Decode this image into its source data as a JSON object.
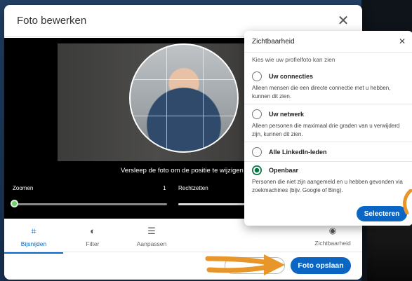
{
  "modal": {
    "title": "Foto bewerken"
  },
  "editor": {
    "drag_hint": "Versleep de foto om de positie te wijzigen",
    "zoom": {
      "label": "Zoomen",
      "value": "1",
      "level": 0
    },
    "straighten": {
      "label": "Rechtzetten"
    }
  },
  "tools": [
    {
      "label": "Bijsnijden",
      "icon": "crop-icon",
      "active": true
    },
    {
      "label": "Filter",
      "icon": "filter-icon",
      "active": false
    },
    {
      "label": "Aanpassen",
      "icon": "sliders-icon",
      "active": false
    }
  ],
  "visibility_tool": {
    "label": "Zichtbaarheid",
    "icon": "eye-icon"
  },
  "footer": {
    "save_label": "Foto opslaan"
  },
  "popover": {
    "title": "Zichtbaarheid",
    "subtitle": "Kies wie uw profielfoto kan zien",
    "options": [
      {
        "label": "Uw connecties",
        "description": "Alleen mensen die een directe connectie met u hebben, kunnen dit zien.",
        "selected": false
      },
      {
        "label": "Uw netwerk",
        "description": "Alleen personen die maximaal drie graden van u verwijderd zijn, kunnen dit zien.",
        "selected": false
      },
      {
        "label": "Alle LinkedIn-leden",
        "description": "",
        "selected": false
      },
      {
        "label": "Openbaar",
        "description": "Personen die niet zijn aangemeld en u hebben gevonden via zoekmachines (bijv. Google of Bing).",
        "selected": true
      }
    ],
    "select_label": "Selecteren"
  },
  "colors": {
    "accent": "#0a66c2",
    "radio_checked": "#057642",
    "slider_thumb": "#6fcf6f",
    "annotation": "#e8962a"
  }
}
